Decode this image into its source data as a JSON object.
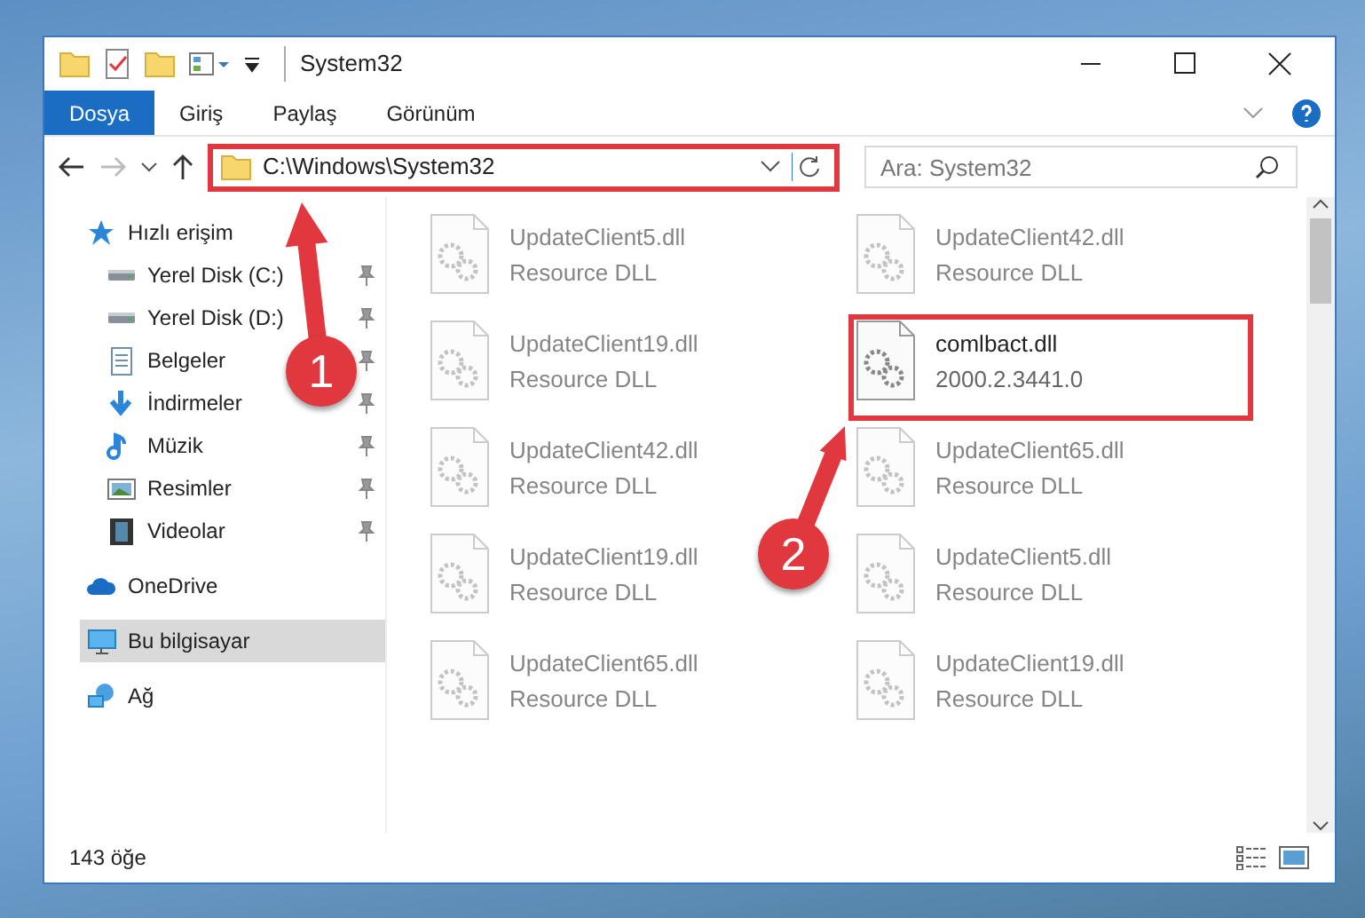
{
  "window": {
    "title": "System32"
  },
  "ribbon_tabs": [
    {
      "label": "Dosya",
      "selected": true
    },
    {
      "label": "Giriş",
      "selected": false
    },
    {
      "label": "Paylaş",
      "selected": false
    },
    {
      "label": "Görünüm",
      "selected": false
    }
  ],
  "address_bar": {
    "path": "C:\\Windows\\System32",
    "highlighted": true
  },
  "search": {
    "placeholder": "Ara: System32"
  },
  "navigation": [
    {
      "label": "Hızlı erişim",
      "kind": "star",
      "selected": false,
      "children": [
        {
          "label": "Yerel Disk (C:)",
          "kind": "drive",
          "pinned": true,
          "selected": false
        },
        {
          "label": "Yerel Disk (D:)",
          "kind": "drive",
          "pinned": true,
          "selected": false
        },
        {
          "label": "Belgeler",
          "kind": "docs",
          "pinned": true,
          "selected": false
        },
        {
          "label": "İndirmeler",
          "kind": "download",
          "pinned": true,
          "selected": false
        },
        {
          "label": "Müzik",
          "kind": "music",
          "pinned": true,
          "selected": false
        },
        {
          "label": "Resimler",
          "kind": "pictures",
          "pinned": true,
          "selected": false
        },
        {
          "label": "Videolar",
          "kind": "video",
          "pinned": true,
          "selected": false
        }
      ]
    },
    {
      "label": "OneDrive",
      "kind": "cloud",
      "selected": false
    },
    {
      "label": "Bu bilgisayar",
      "kind": "pc",
      "selected": true
    },
    {
      "label": "Ağ",
      "kind": "network",
      "selected": false
    }
  ],
  "files": [
    {
      "name": "UpdateClient5.dll",
      "detail": "Resource DLL",
      "blurred": true,
      "highlighted": false
    },
    {
      "name": "UpdateClient42.dll",
      "detail": "Resource DLL",
      "blurred": true,
      "highlighted": false
    },
    {
      "name": "UpdateClient19.dll",
      "detail": "Resource DLL",
      "blurred": true,
      "highlighted": false
    },
    {
      "name": "comlbact.dll",
      "detail": "2000.2.3441.0",
      "blurred": false,
      "highlighted": true
    },
    {
      "name": "UpdateClient42.dll",
      "detail": "Resource DLL",
      "blurred": true,
      "highlighted": false
    },
    {
      "name": "UpdateClient65.dll",
      "detail": "Resource DLL",
      "blurred": true,
      "highlighted": false
    },
    {
      "name": "UpdateClient19.dll",
      "detail": "Resource DLL",
      "blurred": true,
      "highlighted": false
    },
    {
      "name": "UpdateClient5.dll",
      "detail": "Resource DLL",
      "blurred": true,
      "highlighted": false
    },
    {
      "name": "UpdateClient65.dll",
      "detail": "Resource DLL",
      "blurred": true,
      "highlighted": false
    },
    {
      "name": "UpdateClient19.dll",
      "detail": "Resource DLL",
      "blurred": true,
      "highlighted": false
    }
  ],
  "status_bar": {
    "count": "143 öğe"
  },
  "callouts": [
    {
      "number": "1"
    },
    {
      "number": "2"
    }
  ]
}
